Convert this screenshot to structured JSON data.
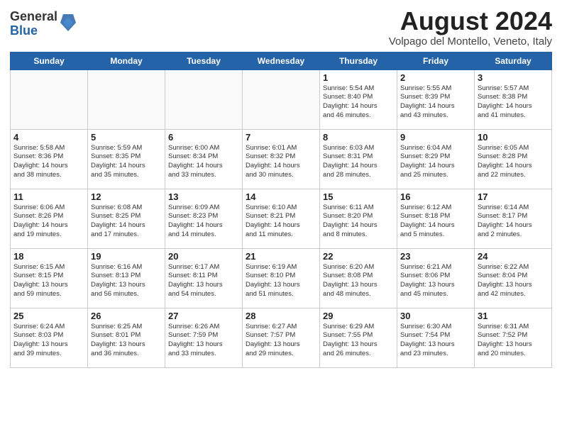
{
  "logo": {
    "general": "General",
    "blue": "Blue"
  },
  "title": "August 2024",
  "subtitle": "Volpago del Montello, Veneto, Italy",
  "headers": [
    "Sunday",
    "Monday",
    "Tuesday",
    "Wednesday",
    "Thursday",
    "Friday",
    "Saturday"
  ],
  "weeks": [
    [
      {
        "day": "",
        "text": ""
      },
      {
        "day": "",
        "text": ""
      },
      {
        "day": "",
        "text": ""
      },
      {
        "day": "",
        "text": ""
      },
      {
        "day": "1",
        "text": "Sunrise: 5:54 AM\nSunset: 8:40 PM\nDaylight: 14 hours\nand 46 minutes."
      },
      {
        "day": "2",
        "text": "Sunrise: 5:55 AM\nSunset: 8:39 PM\nDaylight: 14 hours\nand 43 minutes."
      },
      {
        "day": "3",
        "text": "Sunrise: 5:57 AM\nSunset: 8:38 PM\nDaylight: 14 hours\nand 41 minutes."
      }
    ],
    [
      {
        "day": "4",
        "text": "Sunrise: 5:58 AM\nSunset: 8:36 PM\nDaylight: 14 hours\nand 38 minutes."
      },
      {
        "day": "5",
        "text": "Sunrise: 5:59 AM\nSunset: 8:35 PM\nDaylight: 14 hours\nand 35 minutes."
      },
      {
        "day": "6",
        "text": "Sunrise: 6:00 AM\nSunset: 8:34 PM\nDaylight: 14 hours\nand 33 minutes."
      },
      {
        "day": "7",
        "text": "Sunrise: 6:01 AM\nSunset: 8:32 PM\nDaylight: 14 hours\nand 30 minutes."
      },
      {
        "day": "8",
        "text": "Sunrise: 6:03 AM\nSunset: 8:31 PM\nDaylight: 14 hours\nand 28 minutes."
      },
      {
        "day": "9",
        "text": "Sunrise: 6:04 AM\nSunset: 8:29 PM\nDaylight: 14 hours\nand 25 minutes."
      },
      {
        "day": "10",
        "text": "Sunrise: 6:05 AM\nSunset: 8:28 PM\nDaylight: 14 hours\nand 22 minutes."
      }
    ],
    [
      {
        "day": "11",
        "text": "Sunrise: 6:06 AM\nSunset: 8:26 PM\nDaylight: 14 hours\nand 19 minutes."
      },
      {
        "day": "12",
        "text": "Sunrise: 6:08 AM\nSunset: 8:25 PM\nDaylight: 14 hours\nand 17 minutes."
      },
      {
        "day": "13",
        "text": "Sunrise: 6:09 AM\nSunset: 8:23 PM\nDaylight: 14 hours\nand 14 minutes."
      },
      {
        "day": "14",
        "text": "Sunrise: 6:10 AM\nSunset: 8:21 PM\nDaylight: 14 hours\nand 11 minutes."
      },
      {
        "day": "15",
        "text": "Sunrise: 6:11 AM\nSunset: 8:20 PM\nDaylight: 14 hours\nand 8 minutes."
      },
      {
        "day": "16",
        "text": "Sunrise: 6:12 AM\nSunset: 8:18 PM\nDaylight: 14 hours\nand 5 minutes."
      },
      {
        "day": "17",
        "text": "Sunrise: 6:14 AM\nSunset: 8:17 PM\nDaylight: 14 hours\nand 2 minutes."
      }
    ],
    [
      {
        "day": "18",
        "text": "Sunrise: 6:15 AM\nSunset: 8:15 PM\nDaylight: 13 hours\nand 59 minutes."
      },
      {
        "day": "19",
        "text": "Sunrise: 6:16 AM\nSunset: 8:13 PM\nDaylight: 13 hours\nand 56 minutes."
      },
      {
        "day": "20",
        "text": "Sunrise: 6:17 AM\nSunset: 8:11 PM\nDaylight: 13 hours\nand 54 minutes."
      },
      {
        "day": "21",
        "text": "Sunrise: 6:19 AM\nSunset: 8:10 PM\nDaylight: 13 hours\nand 51 minutes."
      },
      {
        "day": "22",
        "text": "Sunrise: 6:20 AM\nSunset: 8:08 PM\nDaylight: 13 hours\nand 48 minutes."
      },
      {
        "day": "23",
        "text": "Sunrise: 6:21 AM\nSunset: 8:06 PM\nDaylight: 13 hours\nand 45 minutes."
      },
      {
        "day": "24",
        "text": "Sunrise: 6:22 AM\nSunset: 8:04 PM\nDaylight: 13 hours\nand 42 minutes."
      }
    ],
    [
      {
        "day": "25",
        "text": "Sunrise: 6:24 AM\nSunset: 8:03 PM\nDaylight: 13 hours\nand 39 minutes."
      },
      {
        "day": "26",
        "text": "Sunrise: 6:25 AM\nSunset: 8:01 PM\nDaylight: 13 hours\nand 36 minutes."
      },
      {
        "day": "27",
        "text": "Sunrise: 6:26 AM\nSunset: 7:59 PM\nDaylight: 13 hours\nand 33 minutes."
      },
      {
        "day": "28",
        "text": "Sunrise: 6:27 AM\nSunset: 7:57 PM\nDaylight: 13 hours\nand 29 minutes."
      },
      {
        "day": "29",
        "text": "Sunrise: 6:29 AM\nSunset: 7:55 PM\nDaylight: 13 hours\nand 26 minutes."
      },
      {
        "day": "30",
        "text": "Sunrise: 6:30 AM\nSunset: 7:54 PM\nDaylight: 13 hours\nand 23 minutes."
      },
      {
        "day": "31",
        "text": "Sunrise: 6:31 AM\nSunset: 7:52 PM\nDaylight: 13 hours\nand 20 minutes."
      }
    ]
  ]
}
